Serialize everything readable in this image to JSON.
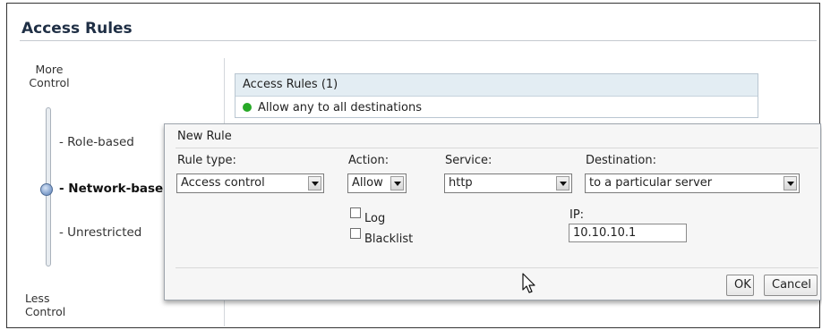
{
  "page": {
    "title": "Access Rules"
  },
  "control_slider": {
    "top_label": "More\nControl",
    "bottom_label": "Less\nControl",
    "levels": [
      "- Role-based",
      "- Network-base",
      "- Unrestricted"
    ],
    "selected_level": "- Network-base"
  },
  "rules_panel": {
    "header": "Access Rules (1)",
    "rules": [
      {
        "text": "Allow any to all destinations",
        "status_color": "#27a927"
      }
    ]
  },
  "dialog": {
    "title": "New Rule",
    "rule_type": {
      "label": "Rule type:",
      "value": "Access control"
    },
    "action": {
      "label": "Action:",
      "value": "Allow"
    },
    "service": {
      "label": "Service:",
      "value": "http"
    },
    "destination": {
      "label": "Destination:",
      "value": "to a particular server"
    },
    "log": {
      "label": "Log",
      "checked": false
    },
    "blacklist": {
      "label": "Blacklist",
      "checked": false
    },
    "ip": {
      "label": "IP:",
      "value": "10.10.10.1"
    },
    "ok_label": "OK",
    "cancel_label": "Cancel"
  },
  "colors": {
    "accent_blue": "#1f2f45",
    "status_green": "#27a927"
  }
}
